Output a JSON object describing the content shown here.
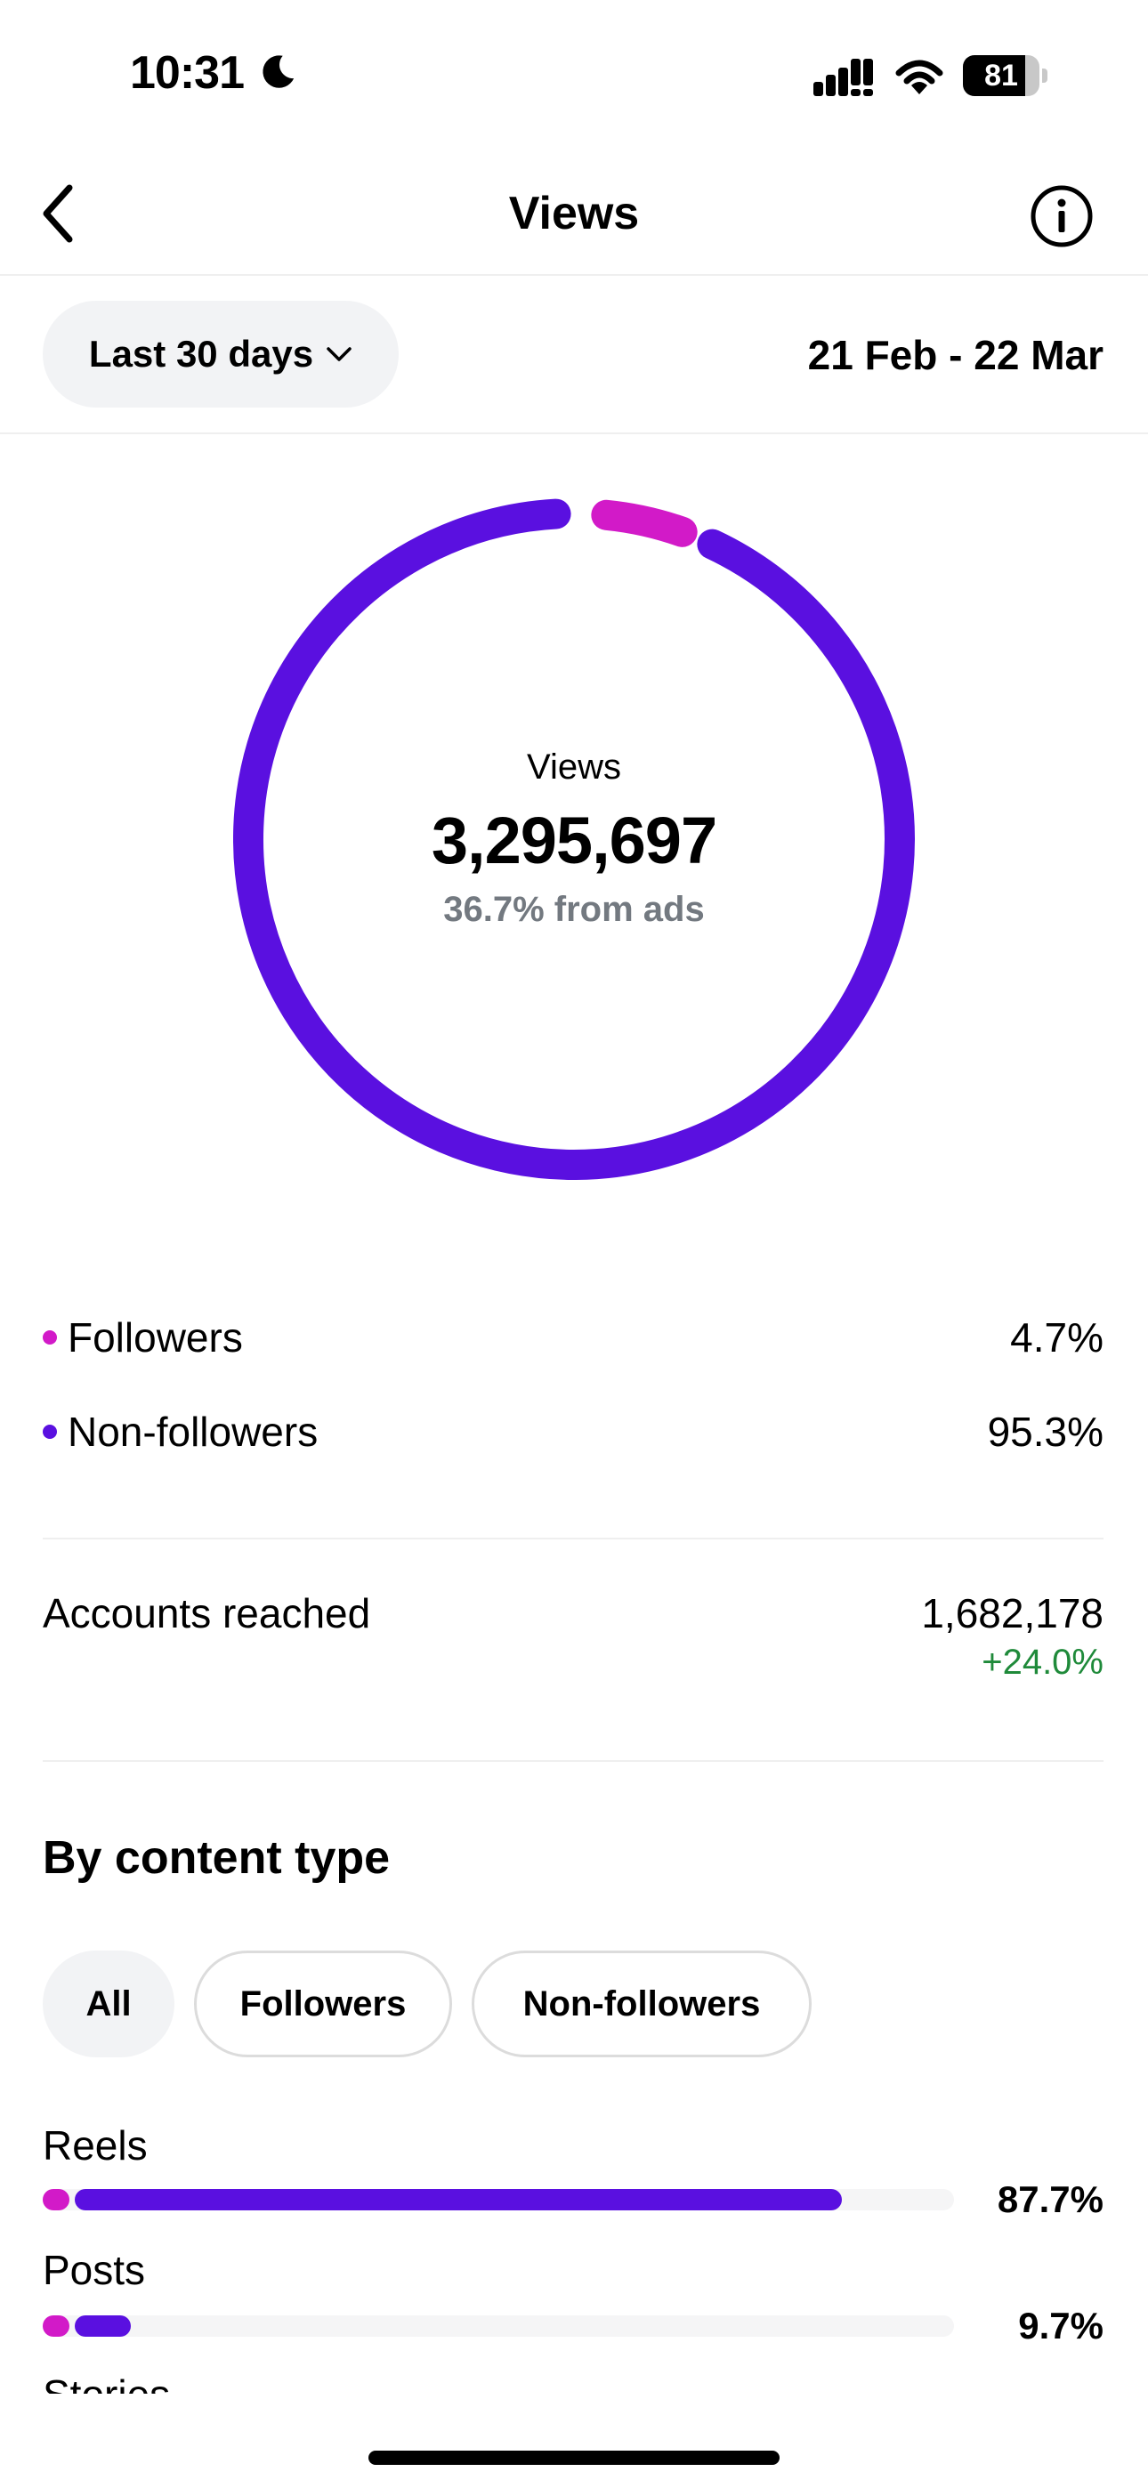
{
  "status_bar": {
    "time": "10:31",
    "battery": "81",
    "battery_level": 0.81
  },
  "nav": {
    "title": "Views"
  },
  "filter": {
    "range_label": "Last 30 days",
    "date_range": "21 Feb - 22 Mar"
  },
  "summary": {
    "label": "Views",
    "total": "3,295,697",
    "from_ads": "36.7% from ads"
  },
  "donut": {
    "followers_share": 0.047,
    "non_followers_share": 0.953
  },
  "audience": [
    {
      "label": "Followers",
      "value": "4.7%"
    },
    {
      "label": "Non-followers",
      "value": "95.3%"
    }
  ],
  "accounts_reached": {
    "label": "Accounts reached",
    "value": "1,682,178",
    "change": "+24.0%"
  },
  "content_type": {
    "title": "By content type",
    "filters": [
      "All",
      "Followers",
      "Non-followers"
    ],
    "rows": [
      {
        "label": "Reels",
        "value": "87.7%",
        "share": 0.877
      },
      {
        "label": "Posts",
        "value": "9.7%",
        "share": 0.097
      },
      {
        "label": "Stories"
      }
    ]
  },
  "colors": {
    "followers": "#d21ac8",
    "non_followers": "#5a10e0",
    "positive": "#1f8a3a"
  }
}
